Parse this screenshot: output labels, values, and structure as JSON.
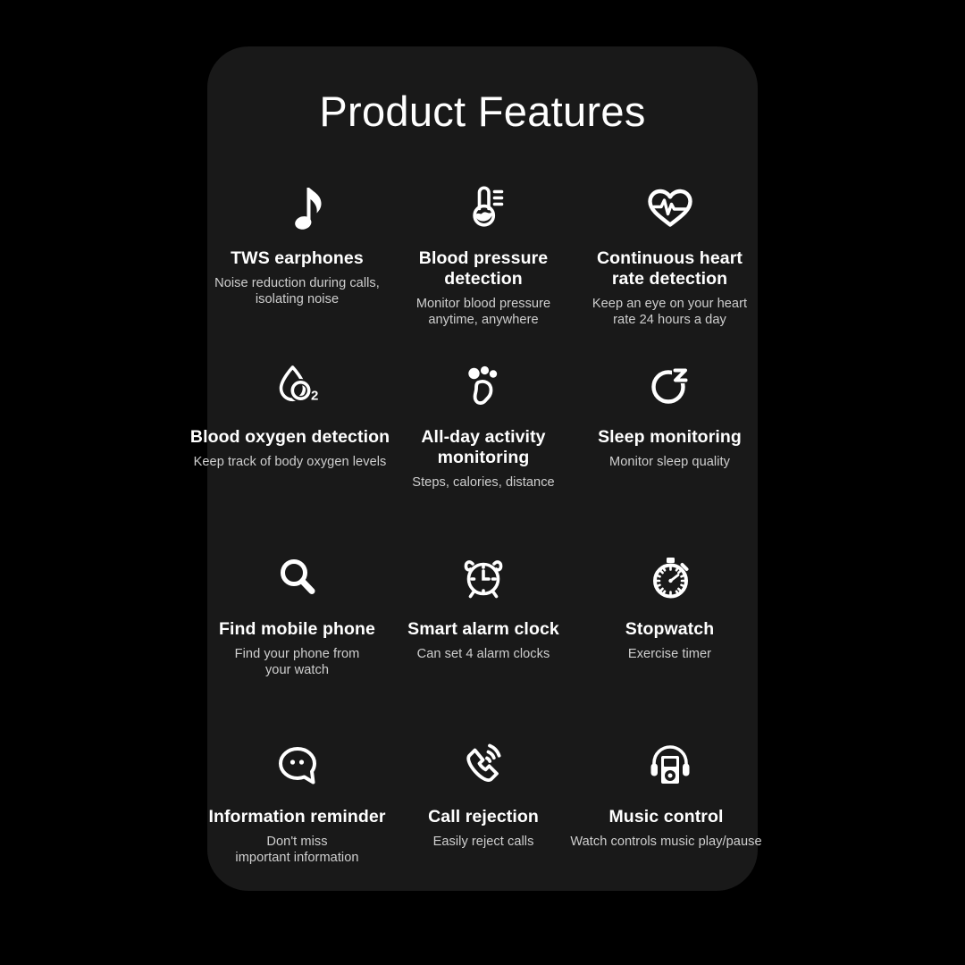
{
  "card": {
    "title": "Product Features",
    "background_color": "#191919",
    "page_background_color": "#000000",
    "text_color": "#ffffff",
    "desc_color": "#cfcfcf"
  },
  "features": [
    {
      "icon": "music-note-icon",
      "title": "TWS earphones",
      "desc": "Noise reduction during calls,\nisolating noise"
    },
    {
      "icon": "thermometer-icon",
      "title": "Blood pressure\ndetection",
      "desc": "Monitor blood pressure\nanytime, anywhere"
    },
    {
      "icon": "heart-pulse-icon",
      "title": "Continuous heart\nrate detection",
      "desc": "Keep an eye on your heart\nrate 24 hours a day"
    },
    {
      "icon": "blood-drop-o2-icon",
      "title": "Blood oxygen detection",
      "desc": "Keep track of body oxygen levels"
    },
    {
      "icon": "footprint-icon",
      "title": "All-day activity\nmonitoring",
      "desc": "Steps, calories, distance"
    },
    {
      "icon": "sleep-moon-z-icon",
      "title": "Sleep monitoring",
      "desc": "Monitor sleep quality"
    },
    {
      "icon": "magnifier-icon",
      "title": "Find mobile phone",
      "desc": "Find your phone from\nyour watch"
    },
    {
      "icon": "alarm-clock-icon",
      "title": "Smart alarm clock",
      "desc": "Can set 4 alarm clocks"
    },
    {
      "icon": "stopwatch-icon",
      "title": "Stopwatch",
      "desc": "Exercise timer"
    },
    {
      "icon": "speech-bubble-icon",
      "title": "Information reminder",
      "desc": "Don't miss\nimportant information"
    },
    {
      "icon": "phone-ringing-icon",
      "title": "Call rejection",
      "desc": "Easily reject calls"
    },
    {
      "icon": "headphones-player-icon",
      "title": "Music control",
      "desc": "Watch controls music play/pause"
    }
  ]
}
